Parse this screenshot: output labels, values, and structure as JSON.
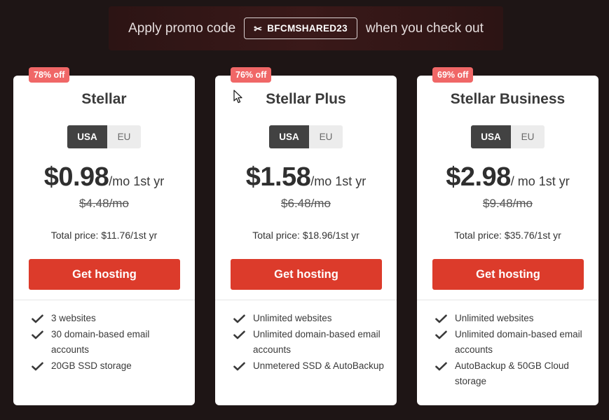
{
  "promo": {
    "prefix": "Apply promo code",
    "code": "BFCMSHARED23",
    "scissors_glyph": "✂",
    "suffix": "when you check out"
  },
  "plans": [
    {
      "badge": "78% off",
      "name": "Stellar",
      "region_options": [
        "USA",
        "EU"
      ],
      "region_selected": "USA",
      "price": "$0.98",
      "price_suffix": "/mo 1st yr",
      "old_price": "$4.48/mo",
      "total": "Total price: $11.76/1st yr",
      "cta": "Get hosting",
      "features": [
        "3 websites",
        "30 domain-based email accounts",
        "20GB SSD storage"
      ]
    },
    {
      "badge": "76% off",
      "name": "Stellar Plus",
      "region_options": [
        "USA",
        "EU"
      ],
      "region_selected": "USA",
      "price": "$1.58",
      "price_suffix": "/mo 1st yr",
      "old_price": "$6.48/mo",
      "total": "Total price: $18.96/1st yr",
      "cta": "Get hosting",
      "features": [
        "Unlimited websites",
        "Unlimited domain-based email accounts",
        "Unmetered SSD & AutoBackup"
      ]
    },
    {
      "badge": "69% off",
      "name": "Stellar Business",
      "region_options": [
        "USA",
        "EU"
      ],
      "region_selected": "USA",
      "price": "$2.98",
      "price_suffix": "/ mo 1st yr",
      "old_price": "$9.48/mo",
      "total": "Total price: $35.76/1st yr",
      "cta": "Get hosting",
      "features": [
        "Unlimited websites",
        "Unlimited domain-based email accounts",
        "AutoBackup & 50GB Cloud storage"
      ]
    }
  ],
  "icons": {
    "feature_check": "check-icon",
    "promo_scissors": "scissors-icon"
  },
  "colors": {
    "background": "#1e1515",
    "accent": "#dc3b2b",
    "badge": "#f06767",
    "region_active": "#424242"
  }
}
